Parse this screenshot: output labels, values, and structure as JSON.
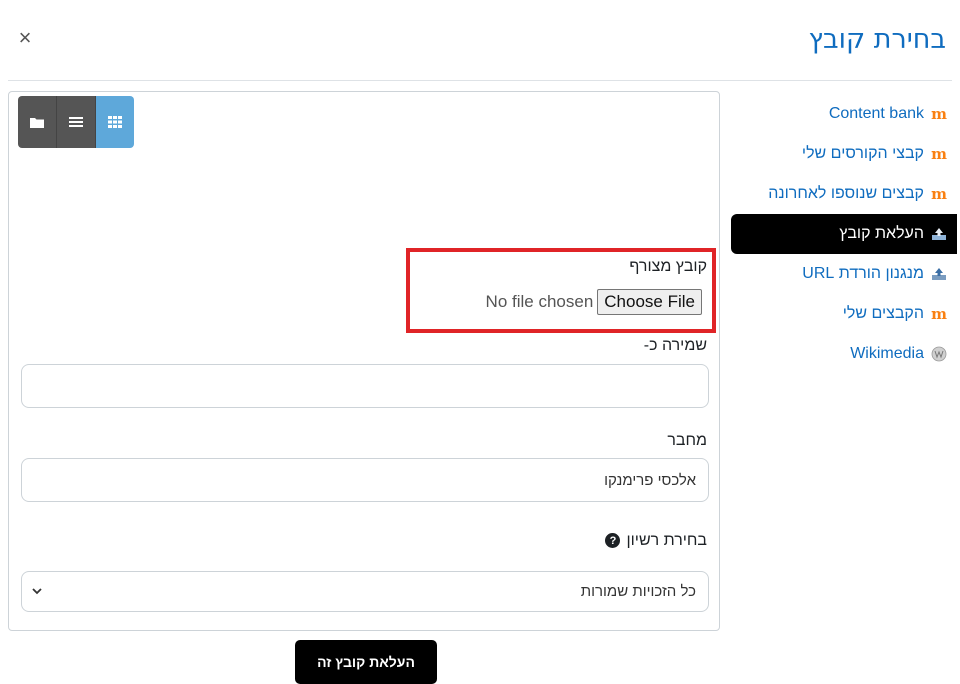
{
  "dialog": {
    "title": "בחירת קובץ",
    "close_symbol": "×"
  },
  "sidebar": {
    "items": [
      {
        "label": "Content bank",
        "icon": "moodle-icon",
        "active": false
      },
      {
        "label": "קבצי הקורסים שלי",
        "icon": "moodle-icon",
        "active": false
      },
      {
        "label": "קבצים שנוספו לאחרונה",
        "icon": "moodle-icon",
        "active": false
      },
      {
        "label": "העלאת קובץ",
        "icon": "upload-icon",
        "active": true
      },
      {
        "label": "מנגנון הורדת URL",
        "icon": "url-download-icon",
        "active": false
      },
      {
        "label": "הקבצים שלי",
        "icon": "moodle-icon",
        "active": false
      },
      {
        "label": "Wikimedia",
        "icon": "wikimedia-icon",
        "active": false
      }
    ]
  },
  "view_toggle": {
    "buttons": [
      "folder-view",
      "list-view",
      "grid-view"
    ],
    "active": "grid-view"
  },
  "form": {
    "attachment_label": "קובץ מצורף",
    "choose_file_button": "Choose File",
    "no_file_text": "No file chosen",
    "save_as_label": "שמירה כ-",
    "save_as_value": "",
    "author_label": "מחבר",
    "author_value": "אלכסי פרימנקו",
    "license_label": "בחירת רשיון",
    "license_value": "כל הזכויות שמורות",
    "submit_button": "העלאת קובץ זה"
  },
  "colors": {
    "accent": "#0f6cbf",
    "active_bg": "#000000",
    "highlight": "#e02427",
    "grid_active": "#5ea8da"
  }
}
